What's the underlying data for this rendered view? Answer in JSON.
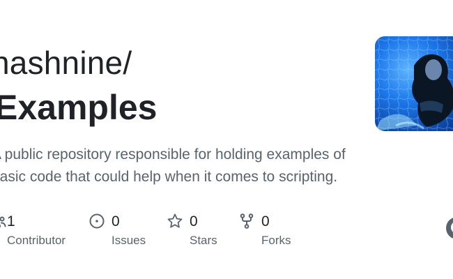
{
  "repo_card": {
    "owner": "nashnine/",
    "name": "Examples",
    "description": "A public repository responsible for holding examples of basic code that could help when it comes to scripting."
  },
  "stats": {
    "contributors": {
      "value": "1",
      "label": "Contributor",
      "icon": "people-icon"
    },
    "issues": {
      "value": "0",
      "label": "Issues",
      "icon": "issue-opened-icon"
    },
    "stars": {
      "value": "0",
      "label": "Stars",
      "icon": "star-icon"
    },
    "forks": {
      "value": "0",
      "label": "Forks",
      "icon": "repo-forked-icon"
    }
  },
  "icons": {
    "avatar": "owner-avatar-photo",
    "brand": "github-mark-icon"
  },
  "colors": {
    "text_primary": "#1f2328",
    "text_secondary": "#59636e",
    "icon_gray": "#59636e",
    "avatar_blue": "#1a6fe0"
  }
}
